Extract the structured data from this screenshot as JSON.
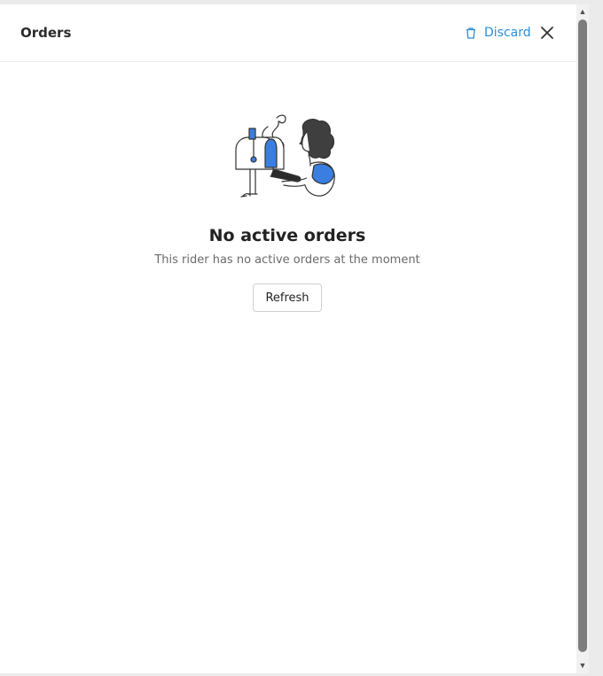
{
  "header": {
    "title": "Orders",
    "discard_label": "Discard",
    "discard_icon": "trash-icon",
    "close_icon": "close-icon"
  },
  "empty_state": {
    "illustration": "empty-mailbox-illustration",
    "title": "No active orders",
    "subtitle": "This rider has no active orders at the moment",
    "refresh_label": "Refresh"
  },
  "colors": {
    "accent": "#2a8fd8",
    "illustration_blue": "#3a7fe0",
    "text_dark": "#222222",
    "text_muted": "#6a6a6a"
  }
}
